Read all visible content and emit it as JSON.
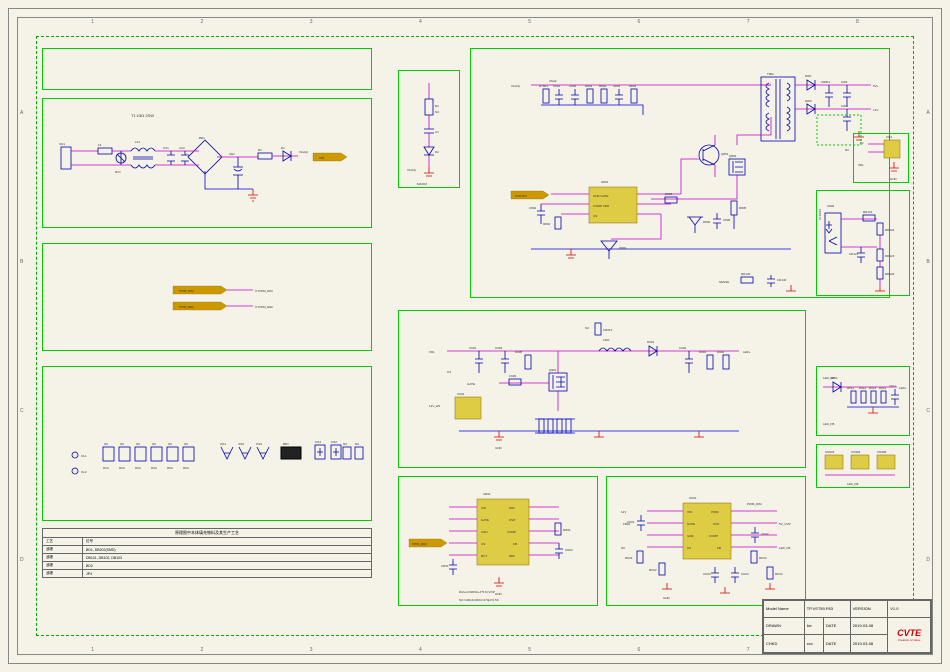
{
  "ruler_cols": [
    "1",
    "2",
    "3",
    "4",
    "5",
    "6",
    "7",
    "8"
  ],
  "ruler_rows": [
    "A",
    "B",
    "C",
    "D"
  ],
  "title_block": {
    "model_label": "Model Name",
    "model_value": "TP.VST59.P83",
    "version_label": "VERSION",
    "version_value": "V1.0",
    "drawn_label": "DRAWN",
    "drawn_value": "lixr",
    "date_label": "DATE",
    "date_value": "2019-03-08",
    "chkd_label": "CHKD",
    "chkd_value": "xxx",
    "date2_label": "DATE",
    "date2_value": "2019-03-08",
    "logo": "CVTE",
    "tagline": "Creation of value"
  },
  "bom": {
    "header": "原理图中本体填充物料及其生产工艺",
    "col1": "工艺",
    "col2": "位号",
    "rows": [
      {
        "c1": "波峰",
        "c2": "BD1, DB202(SMD)"
      },
      {
        "c1": "波峰",
        "c2": "DB101, DB102, DB103"
      },
      {
        "c1": "波峰",
        "c2": "BD2"
      },
      {
        "c1": "波峰",
        "c2": "JP4"
      }
    ]
  },
  "blocks": {
    "input_filter": {
      "title": "T1:15Ω 2SW",
      "parts": [
        "CN1",
        "F1",
        "RV1",
        "LF1",
        "CX1",
        "CX2",
        "BD1",
        "CE1",
        "R1",
        "D1",
        "VinAdj"
      ],
      "out": "VIN"
    },
    "pwm_labels": {
      "tags": [
        "PWM_DIM",
        "PWM_REF"
      ],
      "nets": [
        "O PWM_DIM",
        "O PWM_REF"
      ]
    },
    "snubber": {
      "parts": [
        "R2",
        "C1",
        "NC",
        "D2"
      ],
      "vals": [
        "100K",
        "1n",
        "",
        "1N4148"
      ],
      "vout": "VinAdj",
      "gnd_note": "MAXIM"
    },
    "main_psu": {
      "nets": [
        "VinAdj",
        "Vbulk",
        "GND",
        "SENSE"
      ],
      "ic_label": "U801",
      "ic_pins": [
        "GND GATE",
        "COMP VDD",
        "CS"
      ],
      "parts": [
        "RT801",
        "RT802",
        "C801",
        "C802",
        "C803",
        "C804",
        "C805",
        "R801",
        "R802",
        "R803",
        "R804",
        "R805",
        "R806",
        "D801",
        "D802",
        "D803",
        "Q801",
        "Q802",
        "T801",
        "RW1",
        "RW2",
        "CW1",
        "CW2",
        "CR811"
      ],
      "out_rails": [
        "12V",
        "5VL"
      ],
      "note": "BD9G101G"
    },
    "aux_out": {
      "parts": [
        "CY1",
        "CY3",
        "VDL",
        "GND"
      ],
      "cn": "CN2"
    },
    "opto_fb": {
      "parts": [
        "U802",
        "RR121",
        "RR122",
        "RR123",
        "RR124",
        "CR121"
      ],
      "ic": "PC817A"
    },
    "led_driver": {
      "parts": [
        "U901",
        "Q901",
        "L901",
        "D901",
        "C901",
        "C902",
        "C903",
        "R901",
        "R902",
        "R903",
        "R904",
        "R905"
      ],
      "nets": [
        "VDL",
        "LED+",
        "LED-",
        "12V_EN",
        "LED_FB",
        "GND"
      ]
    },
    "led_fb": {
      "parts": [
        "R911",
        "R912",
        "R913",
        "R914",
        "C911",
        "LED_FB",
        "LED+"
      ]
    },
    "connectors": {
      "labels": [
        "CN903",
        "CN904",
        "CN905"
      ],
      "net": "LED_FB"
    },
    "controller1": {
      "pins": [
        "VIN",
        "DIM",
        "GATE",
        "OVP",
        "IADJ",
        "COMP",
        "CS",
        "FB",
        "RCT",
        "REF"
      ],
      "parts": [
        "UR01",
        "CR01",
        "CR02",
        "RR01",
        "RR02"
      ],
      "note1": "Rshunt=RR02+4*5.6=VOP",
      "note2": "NC=100pF,CR02=470pF,5.5K"
    },
    "controller2": {
      "pins": [
        "VIN",
        "PWM",
        "GATE",
        "OVP",
        "GND",
        "COMP",
        "CS",
        "FB"
      ],
      "parts": [
        "UK01",
        "CK01",
        "CK02",
        "CK03",
        "CK04",
        "RK01",
        "RK02",
        "RK03",
        "RK04"
      ],
      "nets": [
        "12V",
        "PWM_DIM",
        "FB01",
        "GATE",
        "5V_OVP",
        "LED_FB"
      ]
    },
    "dnc": {
      "parts": [
        "OL1",
        "OL2",
        "NC",
        "NC",
        "NC",
        "NC",
        "NC",
        "NC"
      ],
      "ics": [
        "OS1",
        "OS2",
        "OS3",
        "BD1",
        "OS1",
        "OS2"
      ],
      "val": "NC"
    }
  }
}
